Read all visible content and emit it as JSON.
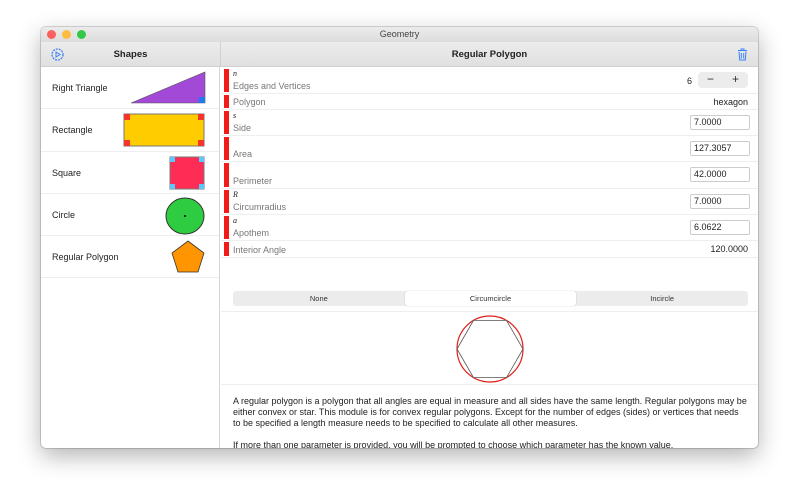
{
  "window": {
    "title": "Geometry"
  },
  "sidebar": {
    "title": "Shapes",
    "items": [
      {
        "label": "Right Triangle"
      },
      {
        "label": "Rectangle"
      },
      {
        "label": "Square"
      },
      {
        "label": "Circle"
      },
      {
        "label": "Regular Polygon"
      }
    ]
  },
  "main": {
    "title": "Regular Polygon",
    "rows": [
      {
        "symbol": "n",
        "label": "Edges and Vertices",
        "value": "6"
      },
      {
        "label": "Polygon",
        "value": "hexagon"
      },
      {
        "symbol": "s",
        "label": "Side",
        "value": "7.0000"
      },
      {
        "label": "Area",
        "value": "127.3057"
      },
      {
        "label": "Perimeter",
        "value": "42.0000"
      },
      {
        "symbol": "R",
        "label": "Circumradius",
        "value": "7.0000"
      },
      {
        "symbol": "a",
        "label": "Apothem",
        "value": "6.0622"
      },
      {
        "label": "Interior Angle",
        "value": "120.0000"
      }
    ],
    "stepper": {
      "minus": "−",
      "plus": "+"
    },
    "segments": [
      "None",
      "Circumcircle",
      "Incircle"
    ],
    "selected_segment": "Circumcircle",
    "description": "A regular polygon is a polygon that all angles are equal in measure and all sides have the same length. Regular polygons may be either convex or star. This module is for convex regular polygons. Except for the number of edges (sides) or vertices that needs to be specified a length measure needs to be specified to calculate all other measures.",
    "note": "If more than one parameter is provided, you will be prompted to choose which parameter has the known value."
  },
  "colors": {
    "accent": "#f21b17",
    "triangle": "#a349d8",
    "rectangle": "#ffcc00",
    "square": "#ff2d55",
    "circle": "#2ecc40",
    "polygon": "#ff9500"
  }
}
